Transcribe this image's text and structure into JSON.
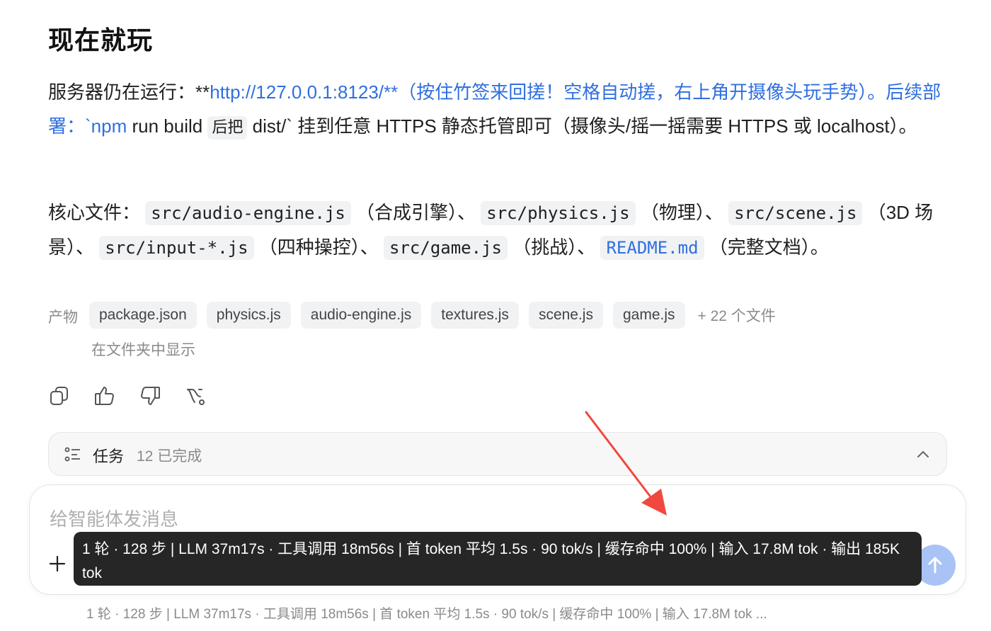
{
  "section_title": "现在就玩",
  "paragraph1": {
    "prefix": "服务器仍在运行：**",
    "link": "http://127.0.0.1:8123/**（按住竹签来回搓！空格自动搓，右上角开摄像头玩手势）。后续部署：`npm",
    "after_link": " run build ",
    "inline": "后把",
    "suffix": " dist/` 挂到任意 HTTPS 静态托管即可（摄像头/摇一摇需要 HTTPS 或 localhost）。"
  },
  "paragraph2": {
    "lead": "核心文件：",
    "files": [
      {
        "code": "src/audio-engine.js",
        "desc": "（合成引擎）、"
      },
      {
        "code": "src/physics.js",
        "desc": "（物理）、"
      },
      {
        "code": "src/scene.js",
        "desc": "（3D 场景）、"
      },
      {
        "code": "src/input-*.js",
        "desc": "（四种操控）、"
      },
      {
        "code": "src/game.js",
        "desc": "（挑战）、"
      }
    ],
    "readme": "README.md",
    "readme_desc": "（完整文档）。"
  },
  "artifacts": {
    "label": "产物",
    "chips": [
      "package.json",
      "physics.js",
      "audio-engine.js",
      "textures.js",
      "scene.js",
      "game.js"
    ],
    "more": "+ 22 个文件",
    "reveal": "在文件夹中显示"
  },
  "actions": {
    "icons": [
      "copy-icon",
      "thumbs-up-icon",
      "thumbs-down-icon",
      "branch-icon"
    ]
  },
  "tasks": {
    "label": "任务",
    "count": "12 已完成"
  },
  "composer": {
    "placeholder": "给智能体发消息",
    "send_color": "#a9c3f7"
  },
  "tooltip": {
    "text": "1 轮 · 128 步 | LLM 37m17s · 工具调用 18m56s | 首 token 平均 1.5s · 90 tok/s | 缓存命中 100% | 输入 17.8M tok · 输出 185K tok"
  },
  "stats_bar": {
    "text": "1 轮 · 128 步   |   LLM 37m17s · 工具调用 18m56s   |   首 token 平均 1.5s · 90 tok/s   |   缓存命中 100%   |   输入 17.8M tok ..."
  },
  "colors": {
    "link": "#2f6fe0",
    "annotation_arrow": "#f0483e",
    "tooltip_bg": "#262626"
  }
}
